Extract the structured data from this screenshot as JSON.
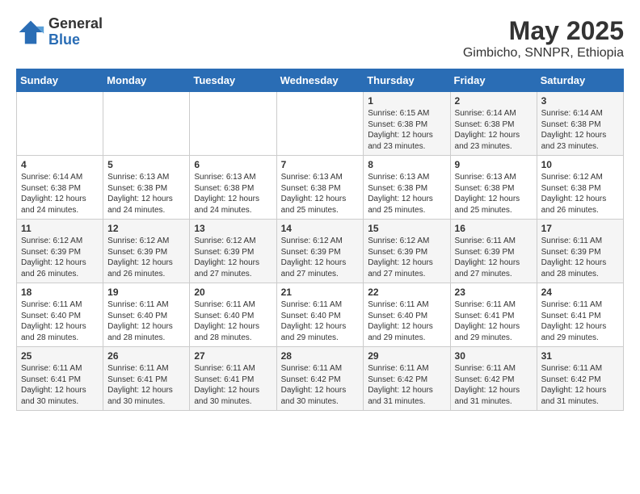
{
  "header": {
    "logo_general": "General",
    "logo_blue": "Blue",
    "title": "May 2025",
    "subtitle": "Gimbicho, SNNPR, Ethiopia"
  },
  "days_of_week": [
    "Sunday",
    "Monday",
    "Tuesday",
    "Wednesday",
    "Thursday",
    "Friday",
    "Saturday"
  ],
  "weeks": [
    [
      {
        "day": "",
        "info": ""
      },
      {
        "day": "",
        "info": ""
      },
      {
        "day": "",
        "info": ""
      },
      {
        "day": "",
        "info": ""
      },
      {
        "day": "1",
        "info": "Sunrise: 6:15 AM\nSunset: 6:38 PM\nDaylight: 12 hours\nand 23 minutes."
      },
      {
        "day": "2",
        "info": "Sunrise: 6:14 AM\nSunset: 6:38 PM\nDaylight: 12 hours\nand 23 minutes."
      },
      {
        "day": "3",
        "info": "Sunrise: 6:14 AM\nSunset: 6:38 PM\nDaylight: 12 hours\nand 23 minutes."
      }
    ],
    [
      {
        "day": "4",
        "info": "Sunrise: 6:14 AM\nSunset: 6:38 PM\nDaylight: 12 hours\nand 24 minutes."
      },
      {
        "day": "5",
        "info": "Sunrise: 6:13 AM\nSunset: 6:38 PM\nDaylight: 12 hours\nand 24 minutes."
      },
      {
        "day": "6",
        "info": "Sunrise: 6:13 AM\nSunset: 6:38 PM\nDaylight: 12 hours\nand 24 minutes."
      },
      {
        "day": "7",
        "info": "Sunrise: 6:13 AM\nSunset: 6:38 PM\nDaylight: 12 hours\nand 25 minutes."
      },
      {
        "day": "8",
        "info": "Sunrise: 6:13 AM\nSunset: 6:38 PM\nDaylight: 12 hours\nand 25 minutes."
      },
      {
        "day": "9",
        "info": "Sunrise: 6:13 AM\nSunset: 6:38 PM\nDaylight: 12 hours\nand 25 minutes."
      },
      {
        "day": "10",
        "info": "Sunrise: 6:12 AM\nSunset: 6:38 PM\nDaylight: 12 hours\nand 26 minutes."
      }
    ],
    [
      {
        "day": "11",
        "info": "Sunrise: 6:12 AM\nSunset: 6:39 PM\nDaylight: 12 hours\nand 26 minutes."
      },
      {
        "day": "12",
        "info": "Sunrise: 6:12 AM\nSunset: 6:39 PM\nDaylight: 12 hours\nand 26 minutes."
      },
      {
        "day": "13",
        "info": "Sunrise: 6:12 AM\nSunset: 6:39 PM\nDaylight: 12 hours\nand 27 minutes."
      },
      {
        "day": "14",
        "info": "Sunrise: 6:12 AM\nSunset: 6:39 PM\nDaylight: 12 hours\nand 27 minutes."
      },
      {
        "day": "15",
        "info": "Sunrise: 6:12 AM\nSunset: 6:39 PM\nDaylight: 12 hours\nand 27 minutes."
      },
      {
        "day": "16",
        "info": "Sunrise: 6:11 AM\nSunset: 6:39 PM\nDaylight: 12 hours\nand 27 minutes."
      },
      {
        "day": "17",
        "info": "Sunrise: 6:11 AM\nSunset: 6:39 PM\nDaylight: 12 hours\nand 28 minutes."
      }
    ],
    [
      {
        "day": "18",
        "info": "Sunrise: 6:11 AM\nSunset: 6:40 PM\nDaylight: 12 hours\nand 28 minutes."
      },
      {
        "day": "19",
        "info": "Sunrise: 6:11 AM\nSunset: 6:40 PM\nDaylight: 12 hours\nand 28 minutes."
      },
      {
        "day": "20",
        "info": "Sunrise: 6:11 AM\nSunset: 6:40 PM\nDaylight: 12 hours\nand 28 minutes."
      },
      {
        "day": "21",
        "info": "Sunrise: 6:11 AM\nSunset: 6:40 PM\nDaylight: 12 hours\nand 29 minutes."
      },
      {
        "day": "22",
        "info": "Sunrise: 6:11 AM\nSunset: 6:40 PM\nDaylight: 12 hours\nand 29 minutes."
      },
      {
        "day": "23",
        "info": "Sunrise: 6:11 AM\nSunset: 6:41 PM\nDaylight: 12 hours\nand 29 minutes."
      },
      {
        "day": "24",
        "info": "Sunrise: 6:11 AM\nSunset: 6:41 PM\nDaylight: 12 hours\nand 29 minutes."
      }
    ],
    [
      {
        "day": "25",
        "info": "Sunrise: 6:11 AM\nSunset: 6:41 PM\nDaylight: 12 hours\nand 30 minutes."
      },
      {
        "day": "26",
        "info": "Sunrise: 6:11 AM\nSunset: 6:41 PM\nDaylight: 12 hours\nand 30 minutes."
      },
      {
        "day": "27",
        "info": "Sunrise: 6:11 AM\nSunset: 6:41 PM\nDaylight: 12 hours\nand 30 minutes."
      },
      {
        "day": "28",
        "info": "Sunrise: 6:11 AM\nSunset: 6:42 PM\nDaylight: 12 hours\nand 30 minutes."
      },
      {
        "day": "29",
        "info": "Sunrise: 6:11 AM\nSunset: 6:42 PM\nDaylight: 12 hours\nand 31 minutes."
      },
      {
        "day": "30",
        "info": "Sunrise: 6:11 AM\nSunset: 6:42 PM\nDaylight: 12 hours\nand 31 minutes."
      },
      {
        "day": "31",
        "info": "Sunrise: 6:11 AM\nSunset: 6:42 PM\nDaylight: 12 hours\nand 31 minutes."
      }
    ]
  ]
}
